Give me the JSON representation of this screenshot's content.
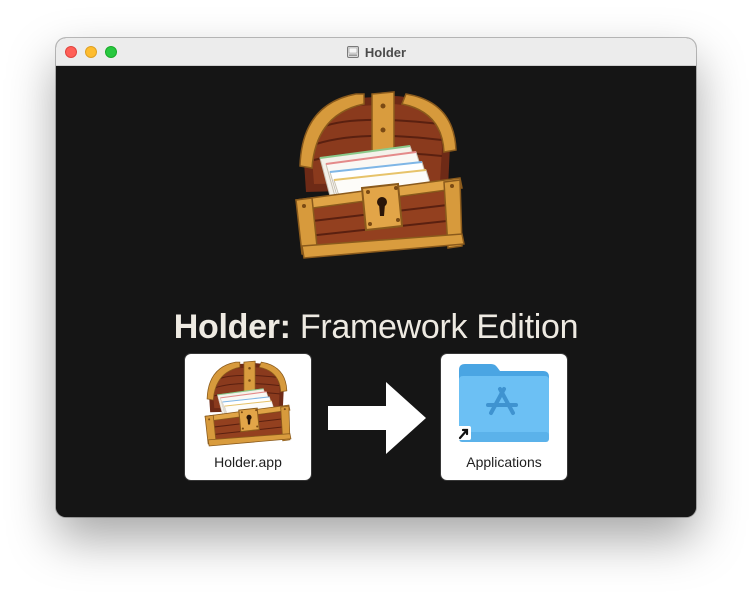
{
  "window": {
    "title": "Holder",
    "title_icon": "disk-image-icon"
  },
  "headline": {
    "bold": "Holder:",
    "rest": "Framework Edition"
  },
  "items": {
    "app": {
      "label": "Holder.app",
      "icon": "treasure-chest-icon"
    },
    "applications": {
      "label": "Applications",
      "icon": "applications-folder-icon",
      "alias_badge": "alias-arrow-icon"
    }
  },
  "colors": {
    "background": "#151515",
    "headline_text": "#eeeae2",
    "folder_blue": "#6cc0f4"
  }
}
